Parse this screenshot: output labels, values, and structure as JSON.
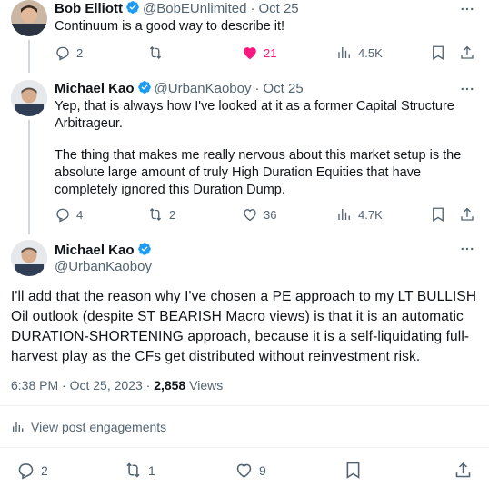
{
  "tweets": [
    {
      "name": "Bob Elliott",
      "handle": "@BobEUnlimited",
      "sep": "·",
      "date": "Oct 25",
      "text": "Continuum is a good way to describe it!",
      "replies": "2",
      "retweets": "",
      "likes": "21",
      "views": "4.5K",
      "liked": true
    },
    {
      "name": "Michael Kao",
      "handle": "@UrbanKaoboy",
      "sep": "·",
      "date": "Oct 25",
      "para1": "Yep, that is always how I've looked at it as a former Capital Structure Arbitrageur.",
      "para2": "The thing that makes me really nervous about this market setup is the absolute large amount of truly High Duration Equities that have completely ignored this Duration Dump.",
      "replies": "4",
      "retweets": "2",
      "likes": "36",
      "views": "4.7K"
    }
  ],
  "main": {
    "name": "Michael Kao",
    "handle": "@UrbanKaoboy",
    "text": "I'll add that the reason why I've chosen a PE approach to my LT BULLISH Oil outlook (despite ST BEARISH Macro views) is that it is an automatic DURATION-SHORTENING approach, because it is a self-liquidating full-harvest play as the CFs get distributed without reinvestment risk.",
    "time": "6:38 PM · Oct 25, 2023 · ",
    "views_count": "2,858",
    "views_label": " Views",
    "engagements": "View post engagements",
    "replies": "2",
    "retweets": "1",
    "likes": "9"
  },
  "colors": {
    "accent": "#1d9bf0",
    "like": "#f91880",
    "text": "#0f1419",
    "muted": "#536471"
  }
}
